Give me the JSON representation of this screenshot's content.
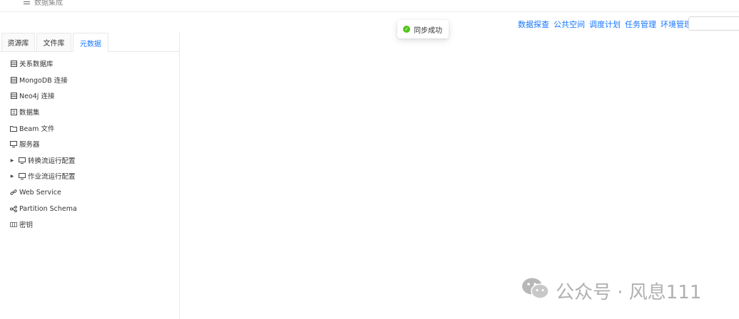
{
  "header": {
    "menu_title": "数据集成"
  },
  "nav": {
    "items": [
      "数据探查",
      "公共空间",
      "调度计划",
      "任务管理",
      "环境管理"
    ]
  },
  "toast": {
    "message": "同步成功"
  },
  "tabs": [
    "资源库",
    "文件库",
    "元数据"
  ],
  "active_tab": "元数据",
  "tree": {
    "items": [
      {
        "label": "关系数据库",
        "icon": "database-icon"
      },
      {
        "label": "MongoDB 连接",
        "icon": "database-icon"
      },
      {
        "label": "Neo4j 连接",
        "icon": "database-icon"
      },
      {
        "label": "数据集",
        "icon": "dataset-icon"
      },
      {
        "label": "Beam 文件",
        "icon": "folder-icon"
      },
      {
        "label": "服务器",
        "icon": "monitor-icon"
      },
      {
        "label": "转换流运行配置",
        "icon": "monitor-icon",
        "expandable": true
      },
      {
        "label": "作业流运行配置",
        "icon": "monitor-icon",
        "expandable": true
      },
      {
        "label": "Web Service",
        "icon": "link-icon"
      },
      {
        "label": "Partition Schema",
        "icon": "share-icon"
      },
      {
        "label": "密钥",
        "icon": "key-icon"
      }
    ]
  },
  "watermark": {
    "text": "公众号 · 风息111"
  },
  "colors": {
    "accent": "#1677ff",
    "success": "#52c41a",
    "watermark": "#b0b0b0"
  }
}
